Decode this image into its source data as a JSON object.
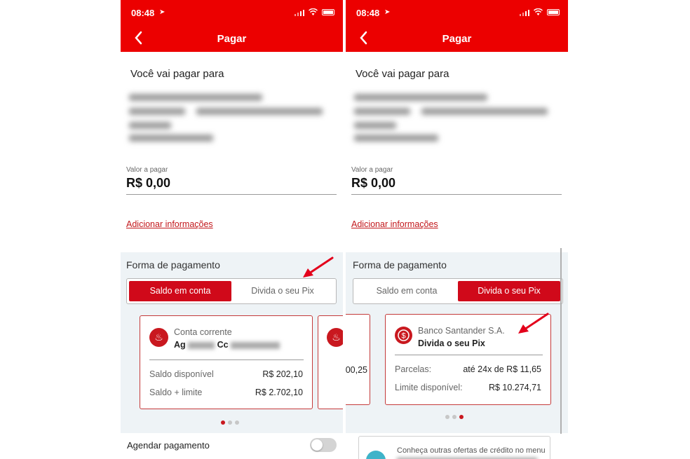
{
  "status": {
    "time": "08:48"
  },
  "nav": {
    "title": "Pagar",
    "back_label": "‹"
  },
  "pay_to_label": "Você vai pagar para",
  "valor": {
    "label": "Valor a pagar",
    "value": "R$ 0,00"
  },
  "add_info_link": "Adicionar informações",
  "forma": {
    "title": "Forma de pagamento",
    "option_saldo": "Saldo em conta",
    "option_divida": "Divida o seu Pix"
  },
  "left_card": {
    "subtitle": "Conta corrente",
    "account_prefix_ag": "Ag",
    "account_prefix_cc": "Cc",
    "row1_label": "Saldo disponível",
    "row1_value": "R$ 202,10",
    "row2_label": "Saldo + limite",
    "row2_value": "R$ 2.702,10",
    "selected_dot": 1
  },
  "right_card": {
    "bank": "Banco Santander S.A.",
    "product": "Divida o seu Pix",
    "row1_label": "Parcelas:",
    "row1_value": "até 24x de R$ 11,65",
    "row2_label": "Limite disponível:",
    "row2_value": "R$ 10.274,71",
    "prev_card_partial": "00,25",
    "selected_dot": 3
  },
  "agendar_label": "Agendar pagamento",
  "offer_text": "Conheça outras ofertas de crédito no menu",
  "colors": {
    "brand": "#ec0000",
    "accent": "#d0091a",
    "annotation": "#e3001b"
  }
}
